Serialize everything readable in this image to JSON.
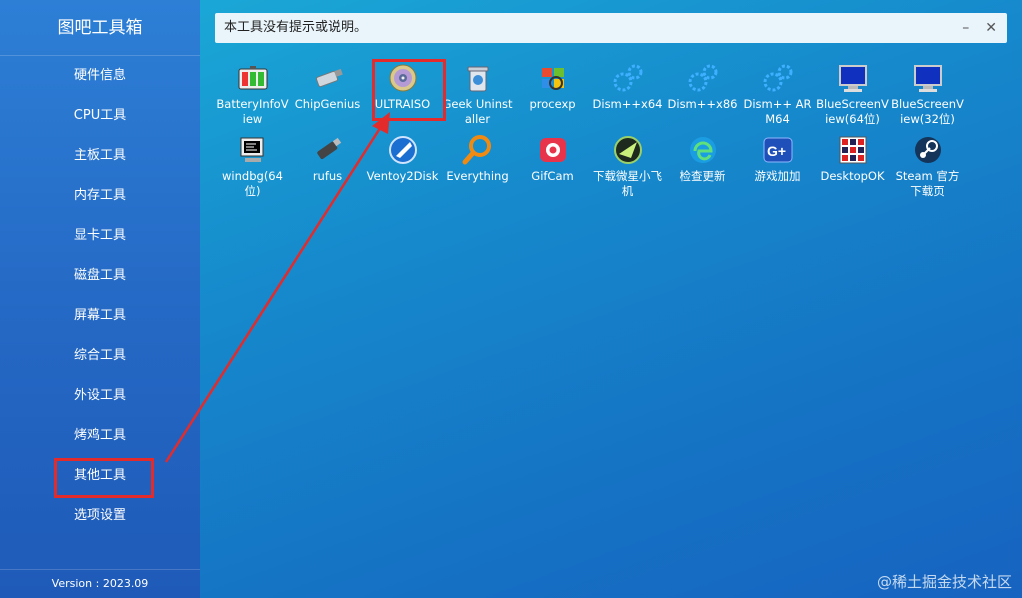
{
  "app": {
    "title": "图吧工具箱",
    "version": "Version : 2023.09"
  },
  "sidebar": {
    "items": [
      {
        "label": "硬件信息"
      },
      {
        "label": "CPU工具"
      },
      {
        "label": "主板工具"
      },
      {
        "label": "内存工具"
      },
      {
        "label": "显卡工具"
      },
      {
        "label": "磁盘工具"
      },
      {
        "label": "屏幕工具"
      },
      {
        "label": "综合工具"
      },
      {
        "label": "外设工具"
      },
      {
        "label": "烤鸡工具"
      },
      {
        "label": "其他工具"
      },
      {
        "label": "选项设置"
      }
    ],
    "selected": "其他工具"
  },
  "notice": {
    "text": "本工具没有提示或说明。",
    "minimize": "–",
    "close": "✕"
  },
  "tools": [
    {
      "label": "BatteryInfoView",
      "icon": "battery-icon"
    },
    {
      "label": "ChipGenius",
      "icon": "usb-drive-icon"
    },
    {
      "label": "ULTRAISO",
      "icon": "disc-icon"
    },
    {
      "label": "Geek Uninstaller",
      "icon": "trash-can-icon"
    },
    {
      "label": "procexp",
      "icon": "windows-flag-icon"
    },
    {
      "label": "Dism++x64",
      "icon": "gears-icon"
    },
    {
      "label": "Dism++x86",
      "icon": "gears-icon"
    },
    {
      "label": "Dism++ ARM64",
      "icon": "gears-icon"
    },
    {
      "label": "BlueScreenView(64位)",
      "icon": "monitor-bluescreen-icon"
    },
    {
      "label": "BlueScreenView(32位)",
      "icon": "monitor-bluescreen-icon"
    },
    {
      "label": "windbg(64位)",
      "icon": "debugger-monitor-icon"
    },
    {
      "label": "rufus",
      "icon": "usb-stick-icon"
    },
    {
      "label": "Ventoy2Disk",
      "icon": "ventoy-icon"
    },
    {
      "label": "Everything",
      "icon": "magnifier-icon"
    },
    {
      "label": "GifCam",
      "icon": "camera-icon"
    },
    {
      "label": "下载微星小飞机",
      "icon": "afterburner-icon"
    },
    {
      "label": "检查更新",
      "icon": "edge-icon"
    },
    {
      "label": "游戏加加",
      "icon": "gplus-icon"
    },
    {
      "label": "DesktopOK",
      "icon": "desktop-grid-icon"
    },
    {
      "label": "Steam 官方下载页",
      "icon": "steam-icon"
    }
  ],
  "watermark": "@稀土掘金技术社区",
  "colors": {
    "highlight": "#e42b2b",
    "sidebar": "#2468c4",
    "main": "#1689cc"
  }
}
